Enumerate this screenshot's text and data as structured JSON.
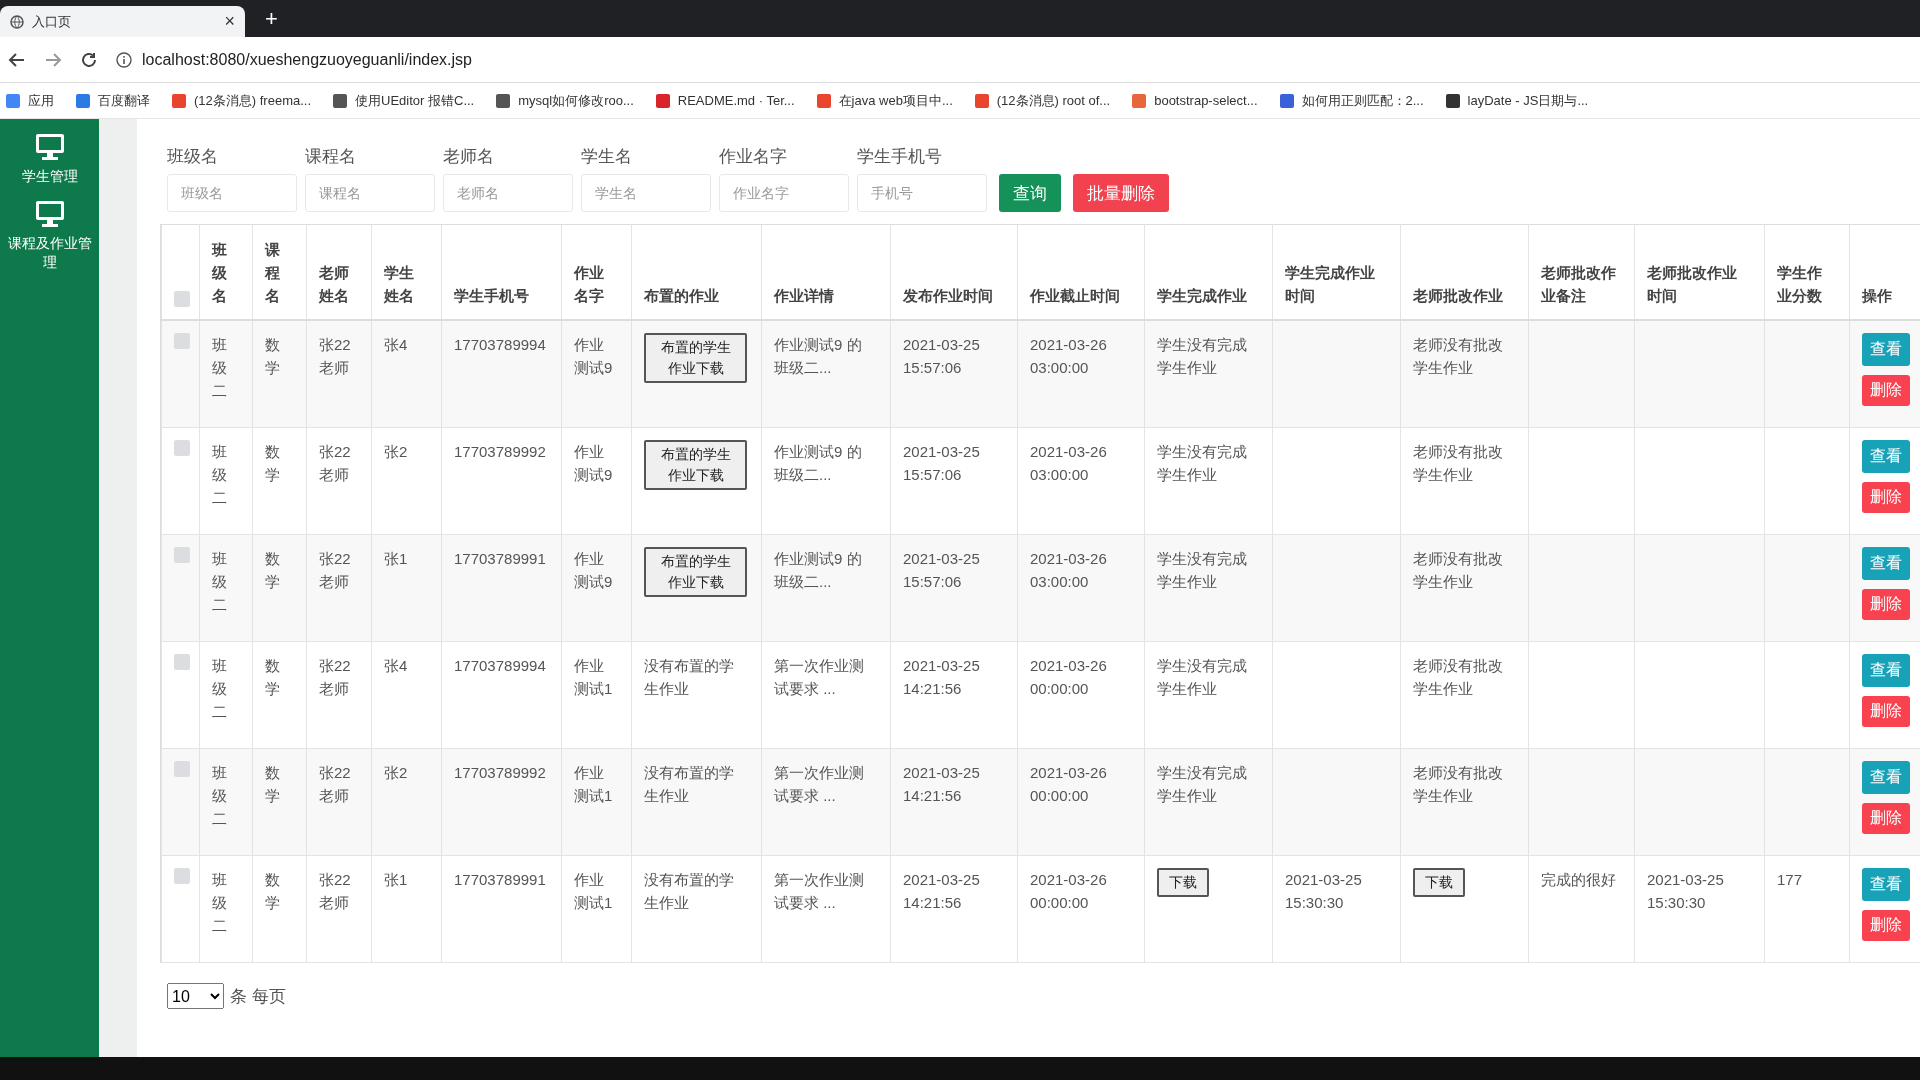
{
  "browser": {
    "tab_title": "入口页",
    "tab_close": "×",
    "new_tab": "+",
    "url": "localhost:8080/xueshengzuoyeguanli/index.jsp",
    "bookmarks": [
      {
        "label": "应用",
        "color": "#4285f4"
      },
      {
        "label": "百度翻译",
        "color": "#2c7be5"
      },
      {
        "label": "(12条消息) freema...",
        "color": "#e8442e"
      },
      {
        "label": "使用UEditor 报错C...",
        "color": "#555555"
      },
      {
        "label": "mysql如何修改roo...",
        "color": "#555555"
      },
      {
        "label": "README.md · Ter...",
        "color": "#d9252a"
      },
      {
        "label": "在java web项目中...",
        "color": "#e8442e"
      },
      {
        "label": "(12条消息) root of...",
        "color": "#e8442e"
      },
      {
        "label": "bootstrap-select...",
        "color": "#e8663b"
      },
      {
        "label": "如何用正则匹配：2...",
        "color": "#3a62d8"
      },
      {
        "label": "layDate - JS日期与...",
        "color": "#333333"
      }
    ]
  },
  "sidebar": {
    "items": [
      {
        "label": "学生管理"
      },
      {
        "label": "课程及作业管理"
      }
    ]
  },
  "filters": [
    {
      "label": "班级名",
      "placeholder": "班级名"
    },
    {
      "label": "课程名",
      "placeholder": "课程名"
    },
    {
      "label": "老师名",
      "placeholder": "老师名"
    },
    {
      "label": "学生名",
      "placeholder": "学生名"
    },
    {
      "label": "作业名字",
      "placeholder": "作业名字"
    },
    {
      "label": "学生手机号",
      "placeholder": "手机号"
    }
  ],
  "buttons": [
    {
      "label": "查询",
      "kind": "primary"
    },
    {
      "label": "批量删除",
      "kind": "danger"
    }
  ],
  "table": {
    "select_all_checked": false,
    "columns": [
      "班级名",
      "课程名",
      "老师姓名",
      "学生姓名",
      "学生手机号",
      "作业名字",
      "布置的作业",
      "作业详情",
      "发布作业时间",
      "作业截止时间",
      "学生完成作业",
      "学生完成作业时间",
      "老师批改作业",
      "老师批改作业备注",
      "老师批改作业时间",
      "学生作业分数",
      "操作"
    ],
    "rows": [
      {
        "checked": false,
        "cells": [
          {
            "kind": "text",
            "text": "班级二"
          },
          {
            "kind": "text",
            "text": "数学"
          },
          {
            "kind": "text",
            "text": "张22老师"
          },
          {
            "kind": "text",
            "text": "张4"
          },
          {
            "kind": "text",
            "text": "17703789994"
          },
          {
            "kind": "text",
            "text": "作业测试9"
          },
          {
            "kind": "button",
            "text": "布置的学生作业下载"
          },
          {
            "kind": "text",
            "text": "作业测试9 的班级二..."
          },
          {
            "kind": "text",
            "text": "2021-03-25 15:57:06"
          },
          {
            "kind": "text",
            "text": "2021-03-26 03:00:00"
          },
          {
            "kind": "text",
            "text": "学生没有完成学生作业"
          },
          {
            "kind": "empty"
          },
          {
            "kind": "text",
            "text": "老师没有批改学生作业"
          },
          {
            "kind": "empty"
          },
          {
            "kind": "empty"
          },
          {
            "kind": "empty"
          }
        ],
        "actions": [
          "查看",
          "删除"
        ]
      },
      {
        "checked": false,
        "cells": [
          {
            "kind": "text",
            "text": "班级二"
          },
          {
            "kind": "text",
            "text": "数学"
          },
          {
            "kind": "text",
            "text": "张22老师"
          },
          {
            "kind": "text",
            "text": "张2"
          },
          {
            "kind": "text",
            "text": "17703789992"
          },
          {
            "kind": "text",
            "text": "作业测试9"
          },
          {
            "kind": "button",
            "text": "布置的学生作业下载"
          },
          {
            "kind": "text",
            "text": "作业测试9 的班级二..."
          },
          {
            "kind": "text",
            "text": "2021-03-25 15:57:06"
          },
          {
            "kind": "text",
            "text": "2021-03-26 03:00:00"
          },
          {
            "kind": "text",
            "text": "学生没有完成学生作业"
          },
          {
            "kind": "empty"
          },
          {
            "kind": "text",
            "text": "老师没有批改学生作业"
          },
          {
            "kind": "empty"
          },
          {
            "kind": "empty"
          },
          {
            "kind": "empty"
          }
        ],
        "actions": [
          "查看",
          "删除"
        ]
      },
      {
        "checked": false,
        "cells": [
          {
            "kind": "text",
            "text": "班级二"
          },
          {
            "kind": "text",
            "text": "数学"
          },
          {
            "kind": "text",
            "text": "张22老师"
          },
          {
            "kind": "text",
            "text": "张1"
          },
          {
            "kind": "text",
            "text": "17703789991"
          },
          {
            "kind": "text",
            "text": "作业测试9"
          },
          {
            "kind": "button",
            "text": "布置的学生作业下载"
          },
          {
            "kind": "text",
            "text": "作业测试9 的班级二..."
          },
          {
            "kind": "text",
            "text": "2021-03-25 15:57:06"
          },
          {
            "kind": "text",
            "text": "2021-03-26 03:00:00"
          },
          {
            "kind": "text",
            "text": "学生没有完成学生作业"
          },
          {
            "kind": "empty"
          },
          {
            "kind": "text",
            "text": "老师没有批改学生作业"
          },
          {
            "kind": "empty"
          },
          {
            "kind": "empty"
          },
          {
            "kind": "empty"
          }
        ],
        "actions": [
          "查看",
          "删除"
        ]
      },
      {
        "checked": false,
        "cells": [
          {
            "kind": "text",
            "text": "班级二"
          },
          {
            "kind": "text",
            "text": "数学"
          },
          {
            "kind": "text",
            "text": "张22老师"
          },
          {
            "kind": "text",
            "text": "张4"
          },
          {
            "kind": "text",
            "text": "17703789994"
          },
          {
            "kind": "text",
            "text": "作业测试1"
          },
          {
            "kind": "text",
            "text": "没有布置的学生作业"
          },
          {
            "kind": "text",
            "text": "第一次作业测试要求 ..."
          },
          {
            "kind": "text",
            "text": "2021-03-25 14:21:56"
          },
          {
            "kind": "text",
            "text": "2021-03-26 00:00:00"
          },
          {
            "kind": "text",
            "text": "学生没有完成学生作业"
          },
          {
            "kind": "empty"
          },
          {
            "kind": "text",
            "text": "老师没有批改学生作业"
          },
          {
            "kind": "empty"
          },
          {
            "kind": "empty"
          },
          {
            "kind": "empty"
          }
        ],
        "actions": [
          "查看",
          "删除"
        ]
      },
      {
        "checked": false,
        "cells": [
          {
            "kind": "text",
            "text": "班级二"
          },
          {
            "kind": "text",
            "text": "数学"
          },
          {
            "kind": "text",
            "text": "张22老师"
          },
          {
            "kind": "text",
            "text": "张2"
          },
          {
            "kind": "text",
            "text": "17703789992"
          },
          {
            "kind": "text",
            "text": "作业测试1"
          },
          {
            "kind": "text",
            "text": "没有布置的学生作业"
          },
          {
            "kind": "text",
            "text": "第一次作业测试要求 ..."
          },
          {
            "kind": "text",
            "text": "2021-03-25 14:21:56"
          },
          {
            "kind": "text",
            "text": "2021-03-26 00:00:00"
          },
          {
            "kind": "text",
            "text": "学生没有完成学生作业"
          },
          {
            "kind": "empty"
          },
          {
            "kind": "text",
            "text": "老师没有批改学生作业"
          },
          {
            "kind": "empty"
          },
          {
            "kind": "empty"
          },
          {
            "kind": "empty"
          }
        ],
        "actions": [
          "查看",
          "删除"
        ]
      },
      {
        "checked": false,
        "cells": [
          {
            "kind": "text",
            "text": "班级二"
          },
          {
            "kind": "text",
            "text": "数学"
          },
          {
            "kind": "text",
            "text": "张22老师"
          },
          {
            "kind": "text",
            "text": "张1"
          },
          {
            "kind": "text",
            "text": "17703789991"
          },
          {
            "kind": "text",
            "text": "作业测试1"
          },
          {
            "kind": "text",
            "text": "没有布置的学生作业"
          },
          {
            "kind": "text",
            "text": "第一次作业测试要求 ..."
          },
          {
            "kind": "text",
            "text": "2021-03-25 14:21:56"
          },
          {
            "kind": "text",
            "text": "2021-03-26 00:00:00"
          },
          {
            "kind": "button",
            "text": "下载"
          },
          {
            "kind": "text",
            "text": "2021-03-25 15:30:30"
          },
          {
            "kind": "button",
            "text": "下载"
          },
          {
            "kind": "text",
            "text": "完成的很好"
          },
          {
            "kind": "text",
            "text": "2021-03-25 15:30:30"
          },
          {
            "kind": "text",
            "text": "177"
          }
        ],
        "actions": [
          "查看",
          "删除"
        ]
      }
    ]
  },
  "pagination": {
    "page_size": "10",
    "suffix": "条 每页"
  }
}
